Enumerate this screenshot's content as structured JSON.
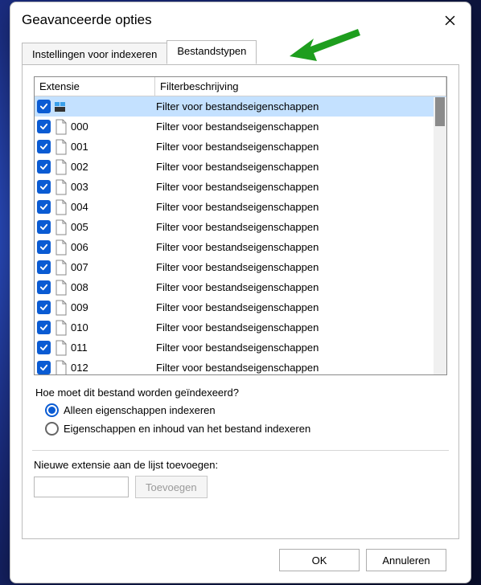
{
  "title": "Geavanceerde opties",
  "tabs": {
    "indexing": "Instellingen voor indexeren",
    "filetypes": "Bestandstypen"
  },
  "columns": {
    "extension": "Extensie",
    "filter": "Filterbeschrijving"
  },
  "rows": [
    {
      "ext": "",
      "filter": "Filter voor bestandseigenschappen",
      "icon": "app"
    },
    {
      "ext": "000",
      "filter": "Filter voor bestandseigenschappen",
      "icon": "file"
    },
    {
      "ext": "001",
      "filter": "Filter voor bestandseigenschappen",
      "icon": "file"
    },
    {
      "ext": "002",
      "filter": "Filter voor bestandseigenschappen",
      "icon": "file"
    },
    {
      "ext": "003",
      "filter": "Filter voor bestandseigenschappen",
      "icon": "file"
    },
    {
      "ext": "004",
      "filter": "Filter voor bestandseigenschappen",
      "icon": "file"
    },
    {
      "ext": "005",
      "filter": "Filter voor bestandseigenschappen",
      "icon": "file"
    },
    {
      "ext": "006",
      "filter": "Filter voor bestandseigenschappen",
      "icon": "file"
    },
    {
      "ext": "007",
      "filter": "Filter voor bestandseigenschappen",
      "icon": "file"
    },
    {
      "ext": "008",
      "filter": "Filter voor bestandseigenschappen",
      "icon": "file"
    },
    {
      "ext": "009",
      "filter": "Filter voor bestandseigenschappen",
      "icon": "file"
    },
    {
      "ext": "010",
      "filter": "Filter voor bestandseigenschappen",
      "icon": "file"
    },
    {
      "ext": "011",
      "filter": "Filter voor bestandseigenschappen",
      "icon": "file"
    },
    {
      "ext": "012",
      "filter": "Filter voor bestandseigenschappen",
      "icon": "file"
    }
  ],
  "index_question": "Hoe moet dit bestand worden geïndexeerd?",
  "radio": {
    "props_only": "Alleen eigenschappen indexeren",
    "props_content": "Eigenschappen en inhoud van het bestand indexeren"
  },
  "add_label": "Nieuwe extensie aan de lijst toevoegen:",
  "add_button": "Toevoegen",
  "buttons": {
    "ok": "OK",
    "cancel": "Annuleren"
  }
}
